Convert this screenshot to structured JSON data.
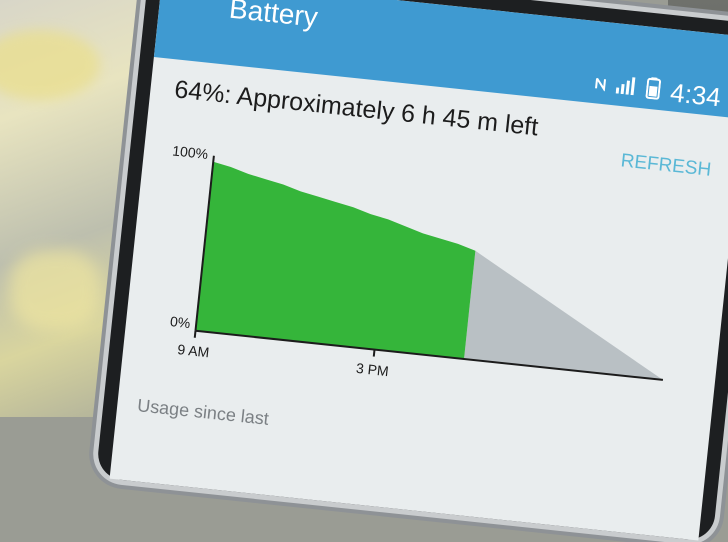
{
  "app": {
    "title": "Battery"
  },
  "status_bar": {
    "time": "4:34"
  },
  "battery": {
    "summary": "64%: Approximately 6 h 45 m left",
    "refresh_label": "REFRESH"
  },
  "chart_data": {
    "type": "area",
    "y_tick_labels": [
      "100%",
      "0%"
    ],
    "x_tick_labels": [
      "9 AM",
      "3 PM"
    ],
    "ylim": [
      0,
      100
    ],
    "series": [
      {
        "values": [
          100,
          98,
          95,
          93,
          91,
          88,
          86,
          84,
          82,
          79,
          77,
          74,
          71,
          69,
          67,
          64
        ]
      }
    ],
    "projection": {
      "from_value": 64,
      "to_value": 0
    },
    "colors": {
      "usage": "#35b53a",
      "projection": "#b9c0c4",
      "axis": "#1c1c1c"
    }
  },
  "footer": {
    "usage_label": "Usage since last"
  }
}
